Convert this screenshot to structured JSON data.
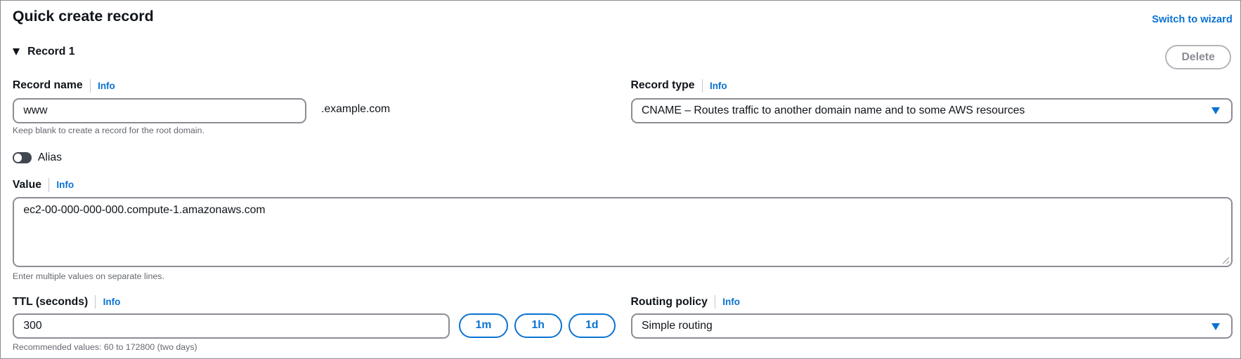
{
  "title": "Quick create record",
  "switch_to_wizard": "Switch to wizard",
  "record": {
    "heading": "Record 1",
    "delete_label": "Delete",
    "record_name": {
      "label": "Record name",
      "info": "Info",
      "value": "www",
      "suffix": ".example.com",
      "hint": "Keep blank to create a record for the root domain."
    },
    "record_type": {
      "label": "Record type",
      "info": "Info",
      "value": "CNAME – Routes traffic to another domain name and to some AWS resources"
    },
    "alias": {
      "label": "Alias",
      "enabled": false
    },
    "value": {
      "label": "Value",
      "info": "Info",
      "value": "ec2-00-000-000-000.compute-1.amazonaws.com",
      "hint": "Enter multiple values on separate lines."
    },
    "ttl": {
      "label": "TTL (seconds)",
      "info": "Info",
      "value": "300",
      "hint": "Recommended values: 60 to 172800 (two days)",
      "presets": [
        "1m",
        "1h",
        "1d"
      ]
    },
    "routing_policy": {
      "label": "Routing policy",
      "info": "Info",
      "value": "Simple routing"
    }
  }
}
